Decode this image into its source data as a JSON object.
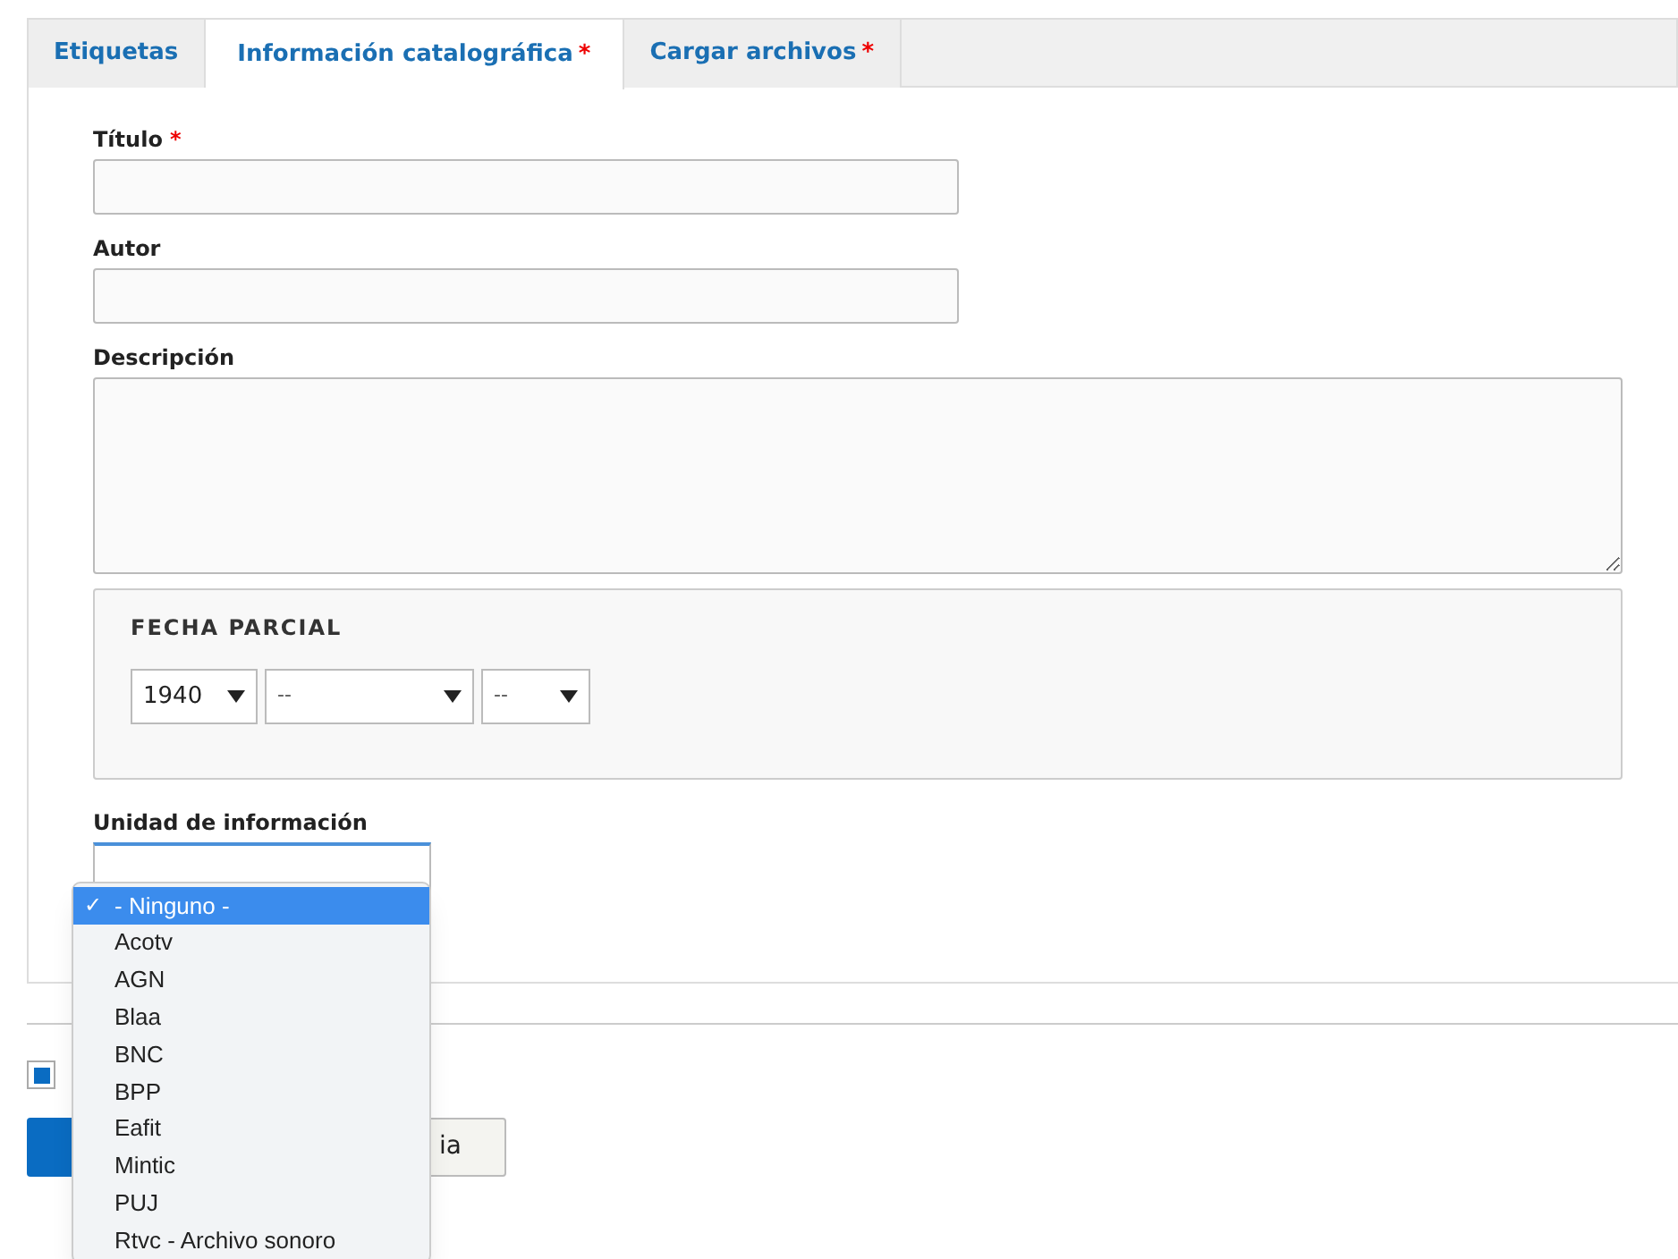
{
  "tabs": [
    {
      "label": "Etiquetas",
      "selected": false
    },
    {
      "label": "Información catalográfica",
      "required_mark": "*",
      "selected": true
    },
    {
      "label": "Cargar archivos",
      "required_mark": "*",
      "selected": false
    }
  ],
  "fields": [
    {
      "kind": "input",
      "label": "Título",
      "required_mark": "*"
    },
    {
      "kind": "input",
      "label": "Autor"
    },
    {
      "kind": "textarea",
      "label": "Descripción"
    }
  ],
  "fecha_parcial": {
    "legend": "FECHA PARCIAL",
    "selects": [
      {
        "value": "1940"
      },
      {
        "value": "--"
      },
      {
        "value": "--"
      }
    ]
  },
  "unidad": {
    "label": "Unidad de información",
    "check_mark": "✓",
    "options": [
      {
        "label": "- Ninguno -",
        "selected": true
      },
      {
        "label": "Acotv",
        "selected": false
      },
      {
        "label": "AGN",
        "selected": false
      },
      {
        "label": "Blaa",
        "selected": false
      },
      {
        "label": "BNC",
        "selected": false
      },
      {
        "label": "BPP",
        "selected": false
      },
      {
        "label": "Eafit",
        "selected": false
      },
      {
        "label": "Mintic",
        "selected": false
      },
      {
        "label": "PUJ",
        "selected": false
      },
      {
        "label": "Rtvc - Archivo sonoro",
        "selected": false
      }
    ]
  },
  "checkbox": {
    "checked": true
  },
  "buttons": [
    {
      "kind": "primary"
    },
    {
      "kind": "secondary",
      "label": "ia"
    }
  ]
}
